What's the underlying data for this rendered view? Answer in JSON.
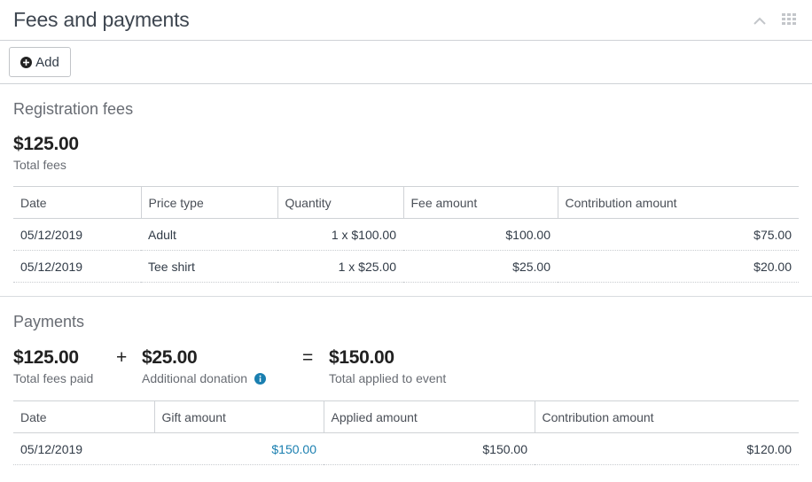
{
  "header": {
    "title": "Fees and payments"
  },
  "toolbar": {
    "add_label": "Add"
  },
  "registration": {
    "title": "Registration fees",
    "total": "$125.00",
    "total_label": "Total fees",
    "columns": [
      "Date",
      "Price type",
      "Quantity",
      "Fee amount",
      "Contribution amount"
    ],
    "rows": [
      [
        "05/12/2019",
        "Adult",
        "1 x $100.00",
        "$100.00",
        "$75.00"
      ],
      [
        "05/12/2019",
        "Tee shirt",
        "1 x $25.00",
        "$25.00",
        "$20.00"
      ]
    ]
  },
  "payments": {
    "title": "Payments",
    "fees_paid": "$125.00",
    "fees_paid_label": "Total fees paid",
    "plus": "+",
    "donation": "$25.00",
    "donation_label": "Additional donation",
    "equals": "=",
    "applied": "$150.00",
    "applied_label": "Total applied to event",
    "columns": [
      "Date",
      "Gift amount",
      "Applied amount",
      "Contribution amount"
    ],
    "rows": [
      [
        "05/12/2019",
        "$150.00",
        "$150.00",
        "$120.00"
      ]
    ]
  },
  "colors": {
    "link": "#1a7fb0",
    "info_icon": "#1a7fb0"
  }
}
